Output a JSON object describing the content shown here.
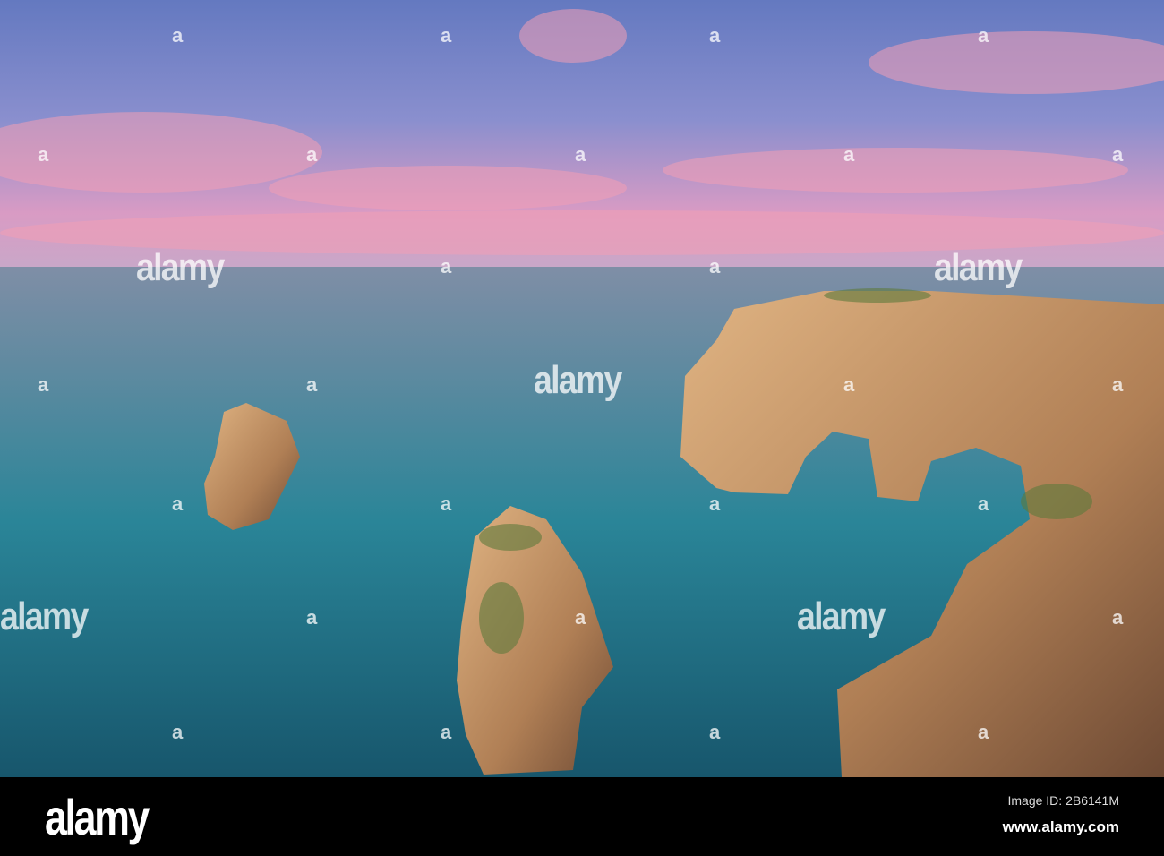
{
  "watermark": {
    "text": "alamy",
    "mark": "a"
  },
  "footer": {
    "logo": "alamy",
    "image_id": "Image ID: 2B6141M",
    "url": "www.alamy.com"
  },
  "colors": {
    "sky_top": "#6a7fc4",
    "sky_pink": "#e596b8",
    "sea_horizon": "#7d8ea6",
    "sea_deep": "#1d6f86",
    "rock": "#c79a6a"
  }
}
